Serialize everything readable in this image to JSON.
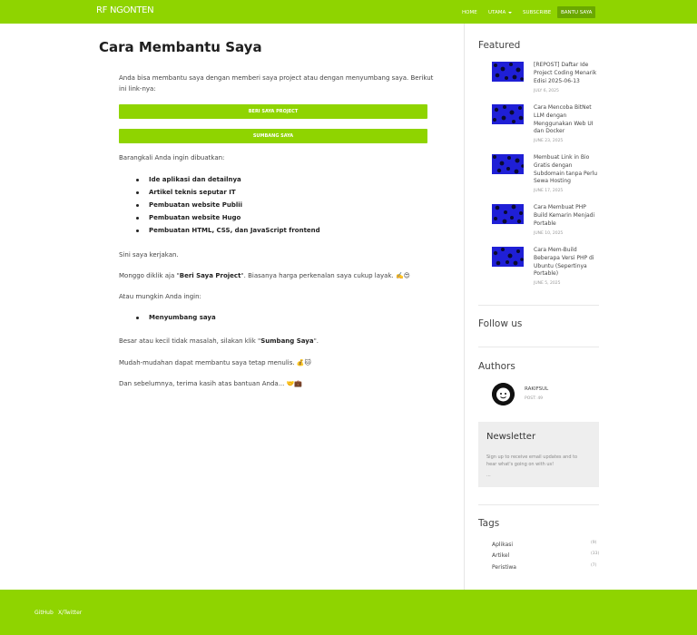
{
  "header": {
    "brand": "RF NGONTEN",
    "nav": [
      {
        "label": "HOME"
      },
      {
        "label": "UTAMA"
      },
      {
        "label": "SUBSCRIBE"
      },
      {
        "label": "BANTU SAYA"
      }
    ],
    "accent_color": "#8fd400"
  },
  "main": {
    "title": "Cara Membantu Saya",
    "intro_line1": "Anda bisa membantu saya dengan memberi saya project atau dengan menyumbang saya. Berikut",
    "intro_line2": "ini link-nya:",
    "buttons": [
      "BERI SAYA PROJECT",
      "SUMBANG SAYA"
    ],
    "list_intro": "Barangkali Anda ingin dibuatkan:",
    "list_items": [
      "Ide aplikasi dan detailnya",
      "Artikel teknis seputar IT",
      "Pembuatan website Publii",
      "Pembuatan website Hugo",
      "Pembuatan HTML, CSS, dan JavaScript frontend"
    ],
    "sini": "Sini saya kerjakan.",
    "monggo_pre": "Monggo diklik aja \"",
    "monggo_bold": "Beri Saya Project",
    "monggo_post": "\". Biasanya harga perkenalan saya cukup layak. ✍️😍",
    "atau": "Atau mungkin Anda ingin:",
    "list2_items": [
      "Menyumbang saya"
    ],
    "besar_pre": "Besar atau kecil tidak masalah, silakan klik \"",
    "besar_bold": "Sumbang Saya",
    "besar_post": "\".",
    "mudah": "Mudah-mudahan dapat membantu saya tetap menulis. 💰🐱",
    "dan": "Dan sebelumnya, terima kasih atas bantuan Anda... 🤝💼"
  },
  "sidebar": {
    "featured_heading": "Featured",
    "featured": [
      {
        "title_lines": [
          "[REPOST] Daftar Ide",
          "Project Coding Menarik",
          "Edisi 2025-06-13"
        ],
        "date": "JULY 6, 2025"
      },
      {
        "title_lines": [
          "Cara Mencoba BitNet",
          "LLM dengan",
          "Menggunakan Web UI",
          "dan Docker"
        ],
        "date": "JUNE 23, 2025"
      },
      {
        "title_lines": [
          "Membuat Link in Bio",
          "Gratis dengan",
          "Subdomain tanpa Perlu",
          "Sewa Hosting"
        ],
        "date": "JUNE 17, 2025"
      },
      {
        "title_lines": [
          "Cara Membuat PHP",
          "Build Kemarin Menjadi",
          "Portable"
        ],
        "date": "JUNE 10, 2025"
      },
      {
        "title_lines": [
          "Cara Mem-Build",
          "Beberapa Versi PHP di",
          "Ubuntu (Sepertinya",
          "Portable)"
        ],
        "date": "JUNE 5, 2025"
      }
    ],
    "follow_heading": "Follow us",
    "authors_heading": "Authors",
    "author": {
      "name": "RAKIFSUL",
      "posts": "POST: 49"
    },
    "newsletter": {
      "title": "Newsletter",
      "desc_line1": "Sign up to receive email updates and to",
      "desc_line2": "hear what's going on with us!",
      "more": "..."
    },
    "tags_heading": "Tags",
    "tags": [
      {
        "name": "Aplikasi",
        "count": "(9)"
      },
      {
        "name": "Artikel",
        "count": "(33)"
      },
      {
        "name": "Peristiwa",
        "count": "(7)"
      }
    ]
  },
  "footer": {
    "links": [
      "GitHub",
      "X/Twitter"
    ]
  }
}
